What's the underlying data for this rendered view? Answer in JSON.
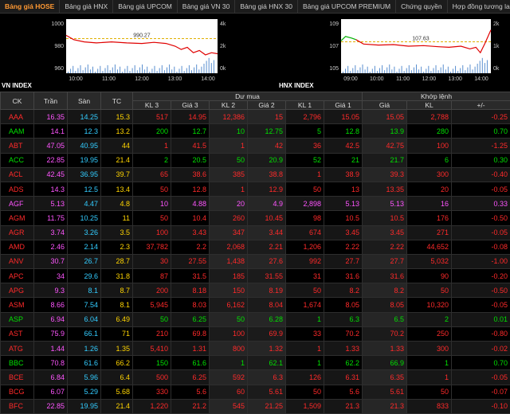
{
  "tabs": [
    "Bảng giá HOSE",
    "Bảng giá HNX",
    "Bảng giá UPCOM",
    "Bảng giá VN 30",
    "Bảng giá HNX 30",
    "Bảng giá UPCOM PREMIUM",
    "Chứng quyền",
    "Hợp đồng tương lai"
  ],
  "active_tab": 0,
  "colors": {
    "up": "#00e000",
    "down": "#ff2a2a",
    "ref": "#ffd400",
    "ceil": "#ff55ff",
    "floor": "#33ccff"
  },
  "vn_index": {
    "label": "VN INDEX",
    "ref_value": "990.27",
    "y_ticks": [
      "1000",
      "980",
      "960"
    ],
    "y2_ticks": [
      "4k",
      "2k",
      "0k"
    ],
    "x_ticks": [
      "10:00",
      "11:00",
      "12:00",
      "13:00",
      "14:00"
    ]
  },
  "hnx_index": {
    "label": "HNX INDEX",
    "ref_value": "107.63",
    "y_ticks": [
      "109",
      "107",
      "105"
    ],
    "y2_ticks": [
      "2k",
      "1k",
      "0k"
    ],
    "x_ticks": [
      "09:00",
      "10:00",
      "11:00",
      "12:00",
      "13:00",
      "14:00"
    ]
  },
  "table": {
    "headers": {
      "ck": "CK",
      "tran": "Trần",
      "san": "Sàn",
      "tc": "TC",
      "du_mua": "Dư mua",
      "khop_lenh": "Khớp lệnh",
      "kl3": "KL 3",
      "gia3": "Giá 3",
      "kl2": "KL 2",
      "gia2": "Giá 2",
      "kl1": "KL 1",
      "gia1": "Giá 1",
      "gia": "Giá",
      "kl": "KL",
      "pm": "+/-"
    },
    "rows": [
      {
        "c": [
          "AAA",
          "16.35",
          "14.25",
          "15.3",
          "517",
          "14.95",
          "12,386",
          "15",
          "2,796",
          "15.05",
          "15.05",
          "2,788",
          "-0.25"
        ],
        "s": "down"
      },
      {
        "c": [
          "AAM",
          "14.1",
          "12.3",
          "13.2",
          "200",
          "12.7",
          "10",
          "12.75",
          "5",
          "12.8",
          "13.9",
          "280",
          "0.70"
        ],
        "s": "up"
      },
      {
        "c": [
          "ABT",
          "47.05",
          "40.95",
          "44",
          "1",
          "41.5",
          "1",
          "42",
          "36",
          "42.5",
          "42.75",
          "100",
          "-1.25"
        ],
        "s": "down"
      },
      {
        "c": [
          "ACC",
          "22.85",
          "19.95",
          "21.4",
          "2",
          "20.5",
          "50",
          "20.9",
          "52",
          "21",
          "21.7",
          "6",
          "0.30"
        ],
        "s": "up"
      },
      {
        "c": [
          "ACL",
          "42.45",
          "36.95",
          "39.7",
          "65",
          "38.6",
          "385",
          "38.8",
          "1",
          "38.9",
          "39.3",
          "300",
          "-0.40"
        ],
        "s": "down"
      },
      {
        "c": [
          "ADS",
          "14.3",
          "12.5",
          "13.4",
          "50",
          "12.8",
          "1",
          "12.9",
          "50",
          "13",
          "13.35",
          "20",
          "-0.05"
        ],
        "s": "down"
      },
      {
        "c": [
          "AGF",
          "5.13",
          "4.47",
          "4.8",
          "10",
          "4.88",
          "20",
          "4.9",
          "2,898",
          "5.13",
          "5.13",
          "16",
          "0.33"
        ],
        "s": "ceil"
      },
      {
        "c": [
          "AGM",
          "11.75",
          "10.25",
          "11",
          "50",
          "10.4",
          "260",
          "10.45",
          "98",
          "10.5",
          "10.5",
          "176",
          "-0.50"
        ],
        "s": "down"
      },
      {
        "c": [
          "AGR",
          "3.74",
          "3.26",
          "3.5",
          "100",
          "3.43",
          "347",
          "3.44",
          "674",
          "3.45",
          "3.45",
          "271",
          "-0.05"
        ],
        "s": "down"
      },
      {
        "c": [
          "AMD",
          "2.46",
          "2.14",
          "2.3",
          "37,782",
          "2.2",
          "2,068",
          "2.21",
          "1,206",
          "2.22",
          "2.22",
          "44,652",
          "-0.08"
        ],
        "s": "down"
      },
      {
        "c": [
          "ANV",
          "30.7",
          "26.7",
          "28.7",
          "30",
          "27.55",
          "1,438",
          "27.6",
          "992",
          "27.7",
          "27.7",
          "5,032",
          "-1.00"
        ],
        "s": "down"
      },
      {
        "c": [
          "APC",
          "34",
          "29.6",
          "31.8",
          "87",
          "31.5",
          "185",
          "31.55",
          "31",
          "31.6",
          "31.6",
          "90",
          "-0.20"
        ],
        "s": "down"
      },
      {
        "c": [
          "APG",
          "9.3",
          "8.1",
          "8.7",
          "200",
          "8.18",
          "150",
          "8.19",
          "50",
          "8.2",
          "8.2",
          "50",
          "-0.50"
        ],
        "s": "down"
      },
      {
        "c": [
          "ASM",
          "8.66",
          "7.54",
          "8.1",
          "5,945",
          "8.03",
          "6,162",
          "8.04",
          "1,674",
          "8.05",
          "8.05",
          "10,320",
          "-0.05"
        ],
        "s": "down"
      },
      {
        "c": [
          "ASP",
          "6.94",
          "6.04",
          "6.49",
          "50",
          "6.25",
          "50",
          "6.28",
          "1",
          "6.3",
          "6.5",
          "2",
          "0.01"
        ],
        "s": "up"
      },
      {
        "c": [
          "AST",
          "75.9",
          "66.1",
          "71",
          "210",
          "69.8",
          "100",
          "69.9",
          "33",
          "70.2",
          "70.2",
          "250",
          "-0.80"
        ],
        "s": "down"
      },
      {
        "c": [
          "ATG",
          "1.44",
          "1.26",
          "1.35",
          "5,410",
          "1.31",
          "800",
          "1.32",
          "1",
          "1.33",
          "1.33",
          "300",
          "-0.02"
        ],
        "s": "down"
      },
      {
        "c": [
          "BBC",
          "70.8",
          "61.6",
          "66.2",
          "150",
          "61.6",
          "1",
          "62.1",
          "1",
          "62.2",
          "66.9",
          "1",
          "0.70"
        ],
        "s": "up"
      },
      {
        "c": [
          "BCE",
          "6.84",
          "5.96",
          "6.4",
          "500",
          "6.25",
          "592",
          "6.3",
          "126",
          "6.31",
          "6.35",
          "1",
          "-0.05"
        ],
        "s": "down"
      },
      {
        "c": [
          "BCG",
          "6.07",
          "5.29",
          "5.68",
          "330",
          "5.6",
          "60",
          "5.61",
          "50",
          "5.6",
          "5.61",
          "50",
          "-0.07"
        ],
        "s": "down"
      },
      {
        "c": [
          "BFC",
          "22.85",
          "19.95",
          "21.4",
          "1,220",
          "21.2",
          "545",
          "21.25",
          "1,509",
          "21.3",
          "21.3",
          "833",
          "-0.10"
        ],
        "s": "down"
      }
    ]
  }
}
